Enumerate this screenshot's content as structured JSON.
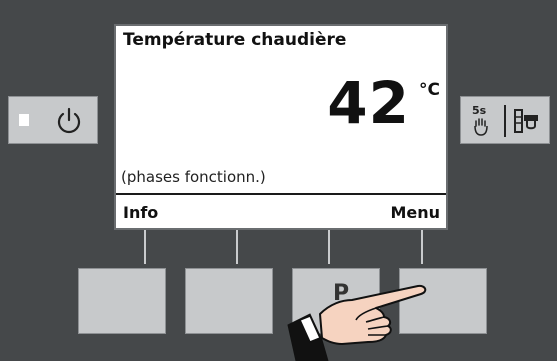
{
  "screen": {
    "title": "Température chaudière",
    "temperature": "42",
    "unit": "°C",
    "status": "(phases fonctionn.)",
    "softkey_left": "Info",
    "softkey_right": "Menu"
  },
  "keys": {
    "key3_label": "P"
  },
  "side_buttons": {
    "func_hold_text": "5s"
  },
  "icons": {
    "power": "power-icon",
    "hand_hold": "hand-hold-icon",
    "boiler_tap": "boiler-tap-icon",
    "pointing_hand": "pointing-hand"
  },
  "colors": {
    "panel": "#45484a",
    "key": "#c7c9cb",
    "screen": "#ffffff"
  }
}
